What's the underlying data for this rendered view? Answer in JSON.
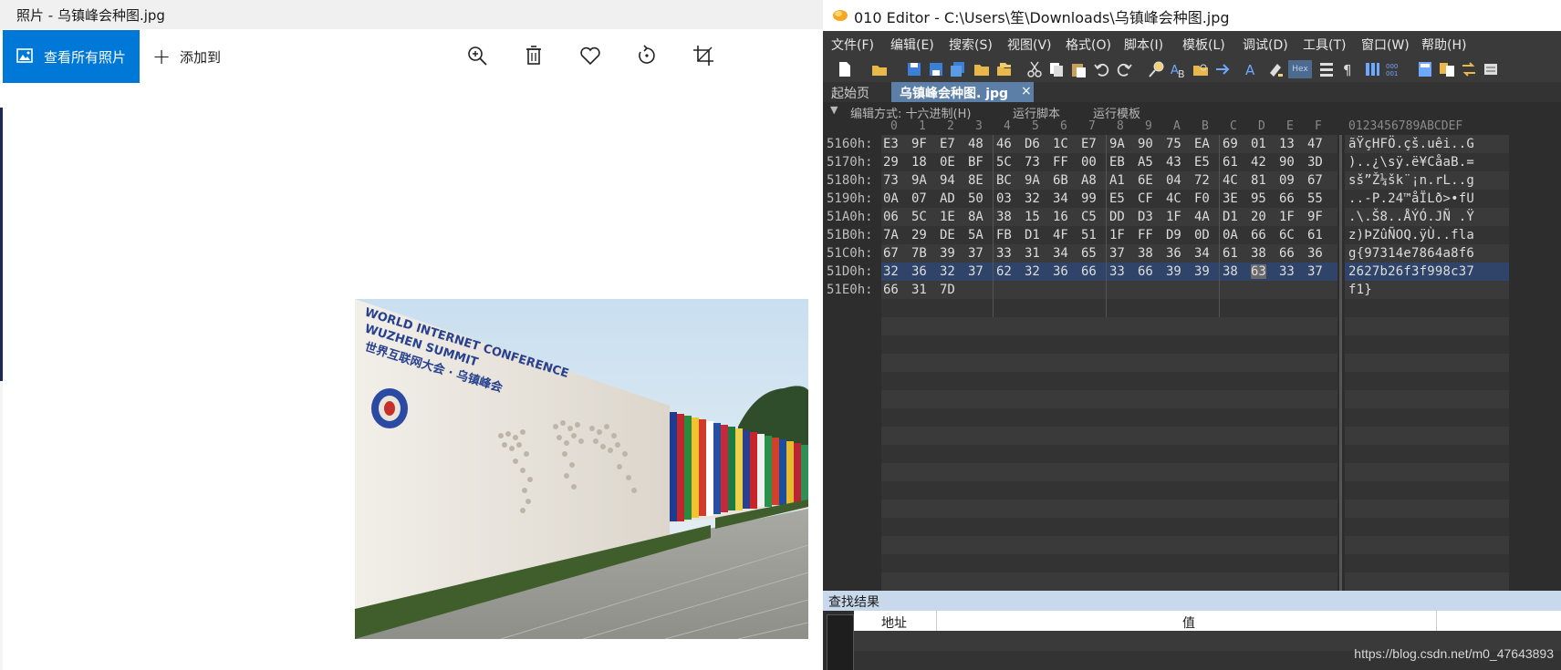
{
  "photos": {
    "window_title": "照片 - 乌镇峰会种图.jpg",
    "view_all_label": "查看所有照片",
    "add_to_label": "添加到",
    "photo_sign_line1": "WORLD INTERNET CONFERENCE",
    "photo_sign_line2": "WUZHEN SUMMIT",
    "photo_sign_cn": "世界互联网大会 · 乌镇峰会"
  },
  "editor": {
    "window_title": "010 Editor - C:\\Users\\笙\\Downloads\\乌镇峰会种图.jpg",
    "menu": [
      "文件(F)",
      "编辑(E)",
      "搜索(S)",
      "视图(V)",
      "格式(O)",
      "脚本(I)",
      "模板(L)",
      "调试(D)",
      "工具(T)",
      "窗口(W)",
      "帮助(H)"
    ],
    "tab_start": "起始页",
    "tab_file": "乌镇峰会种图. jpg",
    "tab_close": "×",
    "edit_mode": "编辑方式: 十六进制(H)",
    "run_script": "运行脚本",
    "run_template": "运行模板",
    "col_headers": [
      "0",
      "1",
      "2",
      "3",
      "4",
      "5",
      "6",
      "7",
      "8",
      "9",
      "A",
      "B",
      "C",
      "D",
      "E",
      "F"
    ],
    "ascii_header": "0123456789ABCDEF",
    "rows": [
      {
        "addr": "5160h:",
        "hex": [
          "E3",
          "9F",
          "E7",
          "48",
          "46",
          "D6",
          "1C",
          "E7",
          "9A",
          "90",
          "75",
          "EA",
          "69",
          "01",
          "13",
          "47"
        ],
        "ascii": "ãŸçHFÖ.çš.uêi..G"
      },
      {
        "addr": "5170h:",
        "hex": [
          "29",
          "18",
          "0E",
          "BF",
          "5C",
          "73",
          "FF",
          "00",
          "EB",
          "A5",
          "43",
          "E5",
          "61",
          "42",
          "90",
          "3D"
        ],
        "ascii": ")..¿\\sÿ.ë¥CåaB.="
      },
      {
        "addr": "5180h:",
        "hex": [
          "73",
          "9A",
          "94",
          "8E",
          "BC",
          "9A",
          "6B",
          "A8",
          "A1",
          "6E",
          "04",
          "72",
          "4C",
          "81",
          "09",
          "67"
        ],
        "ascii": "sš”Ž¼šk¨¡n.rL..g"
      },
      {
        "addr": "5190h:",
        "hex": [
          "0A",
          "07",
          "AD",
          "50",
          "03",
          "32",
          "34",
          "99",
          "E5",
          "CF",
          "4C",
          "F0",
          "3E",
          "95",
          "66",
          "55"
        ],
        "ascii": "..-P.24™åÏLð>•fU"
      },
      {
        "addr": "51A0h:",
        "hex": [
          "06",
          "5C",
          "1E",
          "8A",
          "38",
          "15",
          "16",
          "C5",
          "DD",
          "D3",
          "1F",
          "4A",
          "D1",
          "20",
          "1F",
          "9F"
        ],
        "ascii": ".\\.Š8..ÅÝÓ.JÑ .Ÿ"
      },
      {
        "addr": "51B0h:",
        "hex": [
          "7A",
          "29",
          "DE",
          "5A",
          "FB",
          "D1",
          "4F",
          "51",
          "1F",
          "FF",
          "D9",
          "0D",
          "0A",
          "66",
          "6C",
          "61"
        ],
        "ascii": "z)ÞZûÑOQ.ÿÙ..fla"
      },
      {
        "addr": "51C0h:",
        "hex": [
          "67",
          "7B",
          "39",
          "37",
          "33",
          "31",
          "34",
          "65",
          "37",
          "38",
          "36",
          "34",
          "61",
          "38",
          "66",
          "36"
        ],
        "ascii": "g{97314e7864a8f6"
      },
      {
        "addr": "51D0h:",
        "hex": [
          "32",
          "36",
          "32",
          "37",
          "62",
          "32",
          "36",
          "66",
          "33",
          "66",
          "39",
          "39",
          "38",
          "63",
          "33",
          "37"
        ],
        "ascii": "2627b26f3f998c37"
      },
      {
        "addr": "51E0h:",
        "hex": [
          "66",
          "31",
          "7D"
        ],
        "ascii": "f1}"
      }
    ],
    "search_title": "查找结果",
    "search_col_addr": "地址",
    "search_col_value": "值"
  },
  "watermark": "https://blog.csdn.net/m0_47643893"
}
